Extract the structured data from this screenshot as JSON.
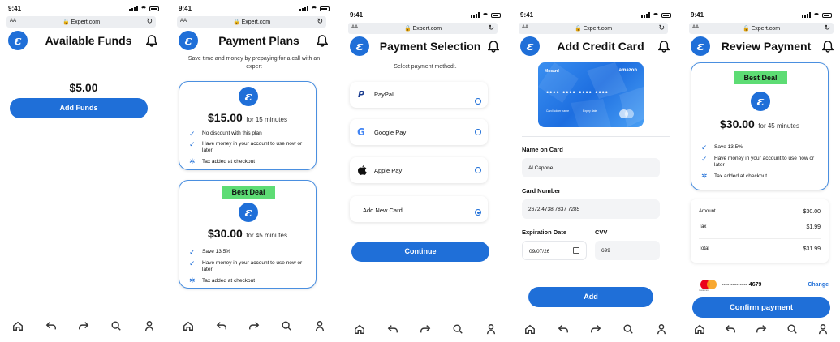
{
  "status": {
    "time": "9:41"
  },
  "browser": {
    "aa": "AA",
    "url": "Expert.com"
  },
  "logo_letter": "ε",
  "screens": {
    "funds": {
      "title": "Available Funds",
      "amount": "$5.00",
      "add_funds": "Add Funds"
    },
    "plans": {
      "title": "Payment Plans",
      "subtitle": "Save time and money by prepaying for a call with an expert",
      "plan1": {
        "price": "$15.00",
        "duration": "for 15 minutes",
        "features": [
          "No discount with this plan",
          "Have money in your account to use now or later",
          "Tax added at checkout"
        ]
      },
      "plan2": {
        "badge": "Best Deal",
        "price": "$30.00",
        "duration": "for 45 minutes",
        "features": [
          "Save 13.5%",
          "Have money in your account to use now or later",
          "Tax added at checkout"
        ]
      }
    },
    "selection": {
      "title": "Payment Selection",
      "prompt": "Select payment method:.",
      "options": [
        "PayPal",
        "Google Pay",
        "Apple Pay",
        "Add New Card"
      ],
      "continue": "Continue"
    },
    "card": {
      "title": "Add Credit Card",
      "card_brand": "Mocard",
      "card_bank": "amazon",
      "card_number_mask": "•••• •••• •••• ••••",
      "card_holder_label": "Card holder name",
      "expiry_label": "Expiry date",
      "name_label": "Name on Card",
      "name_value": "Al Capone",
      "number_label": "Card Number",
      "number_value": "2672 4738 7837 7285",
      "exp_label": "Expiration Date",
      "exp_value": "09/07/26",
      "cvv_label": "CVV",
      "cvv_value": "699",
      "add": "Add"
    },
    "review": {
      "title": "Review Payment",
      "badge": "Best Deal",
      "price": "$30.00",
      "duration": "for 45 minutes",
      "features": [
        "Save 13.5%",
        "Have money in your account to use now or later",
        "Tax added at checkout"
      ],
      "amount_label": "Amount",
      "amount_value": "$30.00",
      "tax_label": "Tax",
      "tax_value": "$1.99",
      "total_label": "Total",
      "total_value": "$31.99",
      "card_mask": "---- ---- ---- 4679",
      "card_brand_small": "mastercard",
      "change": "Change",
      "confirm": "Confirm payment"
    }
  },
  "colors": {
    "accent": "#1f6fd8",
    "badge": "#5ddc74",
    "card_border": "#4a8fe0"
  },
  "nav_icons": [
    "home-icon",
    "back-icon",
    "forward-icon",
    "search-icon",
    "profile-icon"
  ]
}
